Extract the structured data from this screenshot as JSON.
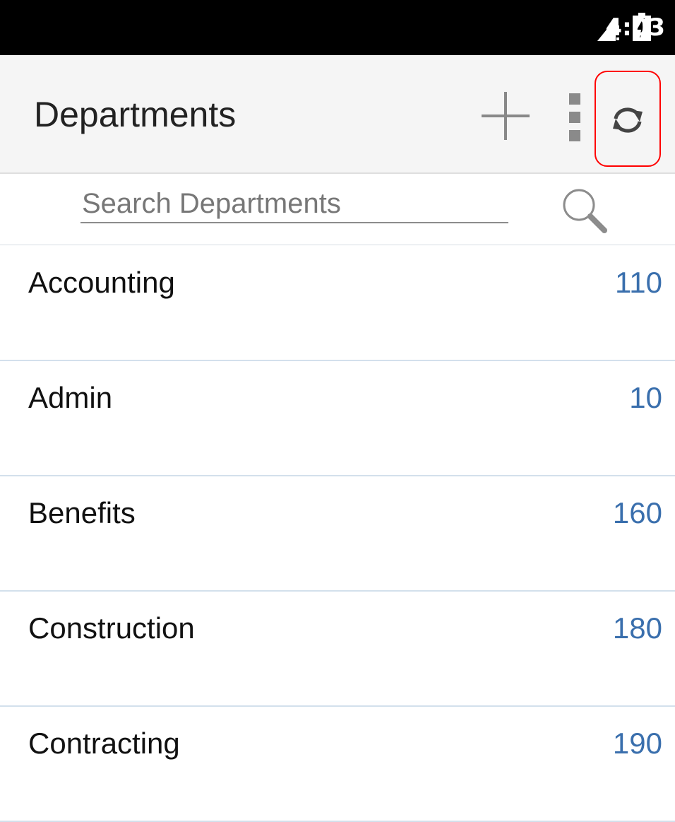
{
  "status_bar": {
    "time": "4:03",
    "icons": [
      "signal-alert-icon",
      "battery-charging-icon"
    ]
  },
  "app_bar": {
    "title": "Departments",
    "actions": [
      "add-icon",
      "more-vert-icon",
      "refresh-icon"
    ],
    "highlight_color": "#ff0000"
  },
  "search": {
    "placeholder": "Search Departments",
    "value": "",
    "icon": "search-icon"
  },
  "departments": [
    {
      "name": "Accounting",
      "id": "110"
    },
    {
      "name": "Admin",
      "id": "10"
    },
    {
      "name": "Benefits",
      "id": "160"
    },
    {
      "name": "Construction",
      "id": "180"
    },
    {
      "name": "Contracting",
      "id": "190"
    }
  ],
  "colors": {
    "accent_number": "#3a6fad",
    "divider": "#d3e0ec",
    "app_bar_bg": "#f5f5f5"
  }
}
